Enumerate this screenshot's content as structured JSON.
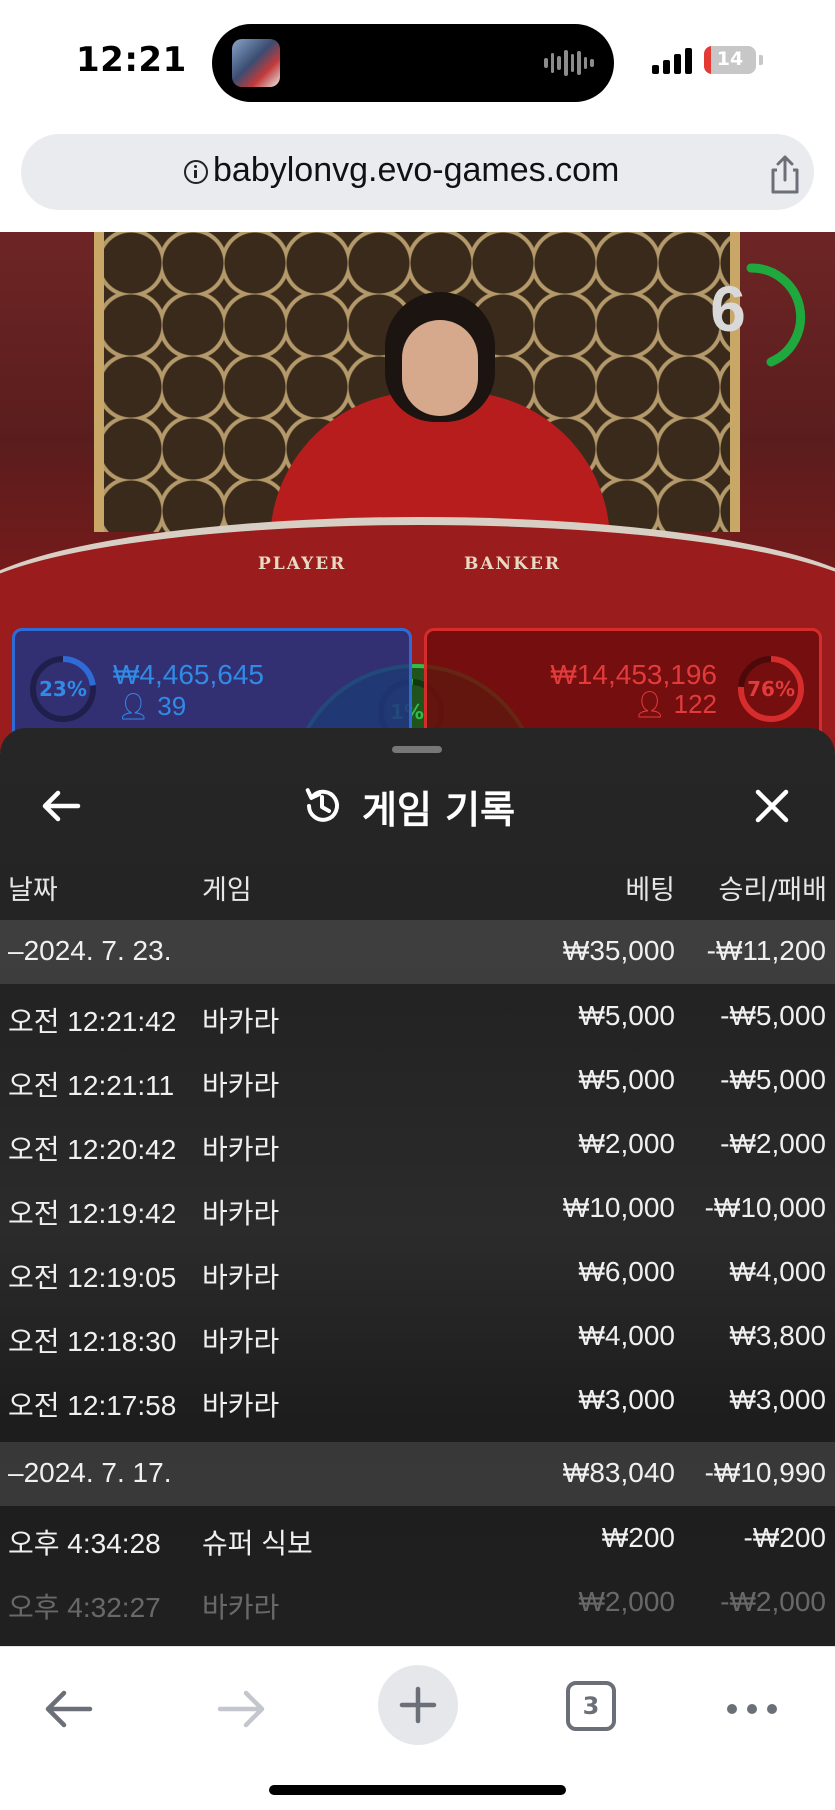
{
  "status_bar": {
    "time": "12:21",
    "battery": "14",
    "battery_level": 0.14
  },
  "browser": {
    "url": "babylonvg.evo-games.com",
    "tab_count": "3"
  },
  "video": {
    "timer": "6",
    "table_labels": {
      "player": "PLAYER",
      "banker": "BANKER"
    },
    "player_bet": {
      "percent": "23%",
      "amount": "₩4,465,645",
      "count": "39",
      "color": "#2f6bd6"
    },
    "tie_bet": {
      "percent": "1%",
      "color": "#2fbf47"
    },
    "banker_bet": {
      "percent": "76%",
      "amount": "₩14,453,196",
      "count": "122",
      "color": "#d62c2c"
    }
  },
  "sheet": {
    "title": "게임 기록",
    "icons": {
      "back": "arrow-left-icon",
      "history": "history-icon",
      "close": "close-icon"
    },
    "columns": {
      "date": "날짜",
      "game": "게임",
      "bet": "베팅",
      "result": "승리/패배"
    },
    "groups": [
      {
        "date": "–2024. 7. 23.",
        "bet": "₩35,000",
        "result": "-₩11,200",
        "rows": [
          {
            "time": "오전 12:21:42",
            "game": "바카라",
            "bet": "₩5,000",
            "result": "-₩5,000"
          },
          {
            "time": "오전 12:21:11",
            "game": "바카라",
            "bet": "₩5,000",
            "result": "-₩5,000"
          },
          {
            "time": "오전 12:20:42",
            "game": "바카라",
            "bet": "₩2,000",
            "result": "-₩2,000"
          },
          {
            "time": "오전 12:19:42",
            "game": "바카라",
            "bet": "₩10,000",
            "result": "-₩10,000"
          },
          {
            "time": "오전 12:19:05",
            "game": "바카라",
            "bet": "₩6,000",
            "result": "₩4,000"
          },
          {
            "time": "오전 12:18:30",
            "game": "바카라",
            "bet": "₩4,000",
            "result": "₩3,800"
          },
          {
            "time": "오전 12:17:58",
            "game": "바카라",
            "bet": "₩3,000",
            "result": "₩3,000"
          }
        ]
      },
      {
        "date": "–2024. 7. 17.",
        "bet": "₩83,040",
        "result": "-₩10,990",
        "rows": [
          {
            "time": "오후 4:34:28",
            "game": "슈퍼 식보",
            "bet": "₩200",
            "result": "-₩200"
          },
          {
            "time": "오후 4:32:27",
            "game": "바카라",
            "bet": "₩2,000",
            "result": "-₩2,000"
          }
        ]
      }
    ]
  },
  "toolbar": {
    "icons": [
      "back-icon",
      "forward-icon",
      "plus-icon",
      "tabs-icon",
      "more-icon"
    ]
  }
}
